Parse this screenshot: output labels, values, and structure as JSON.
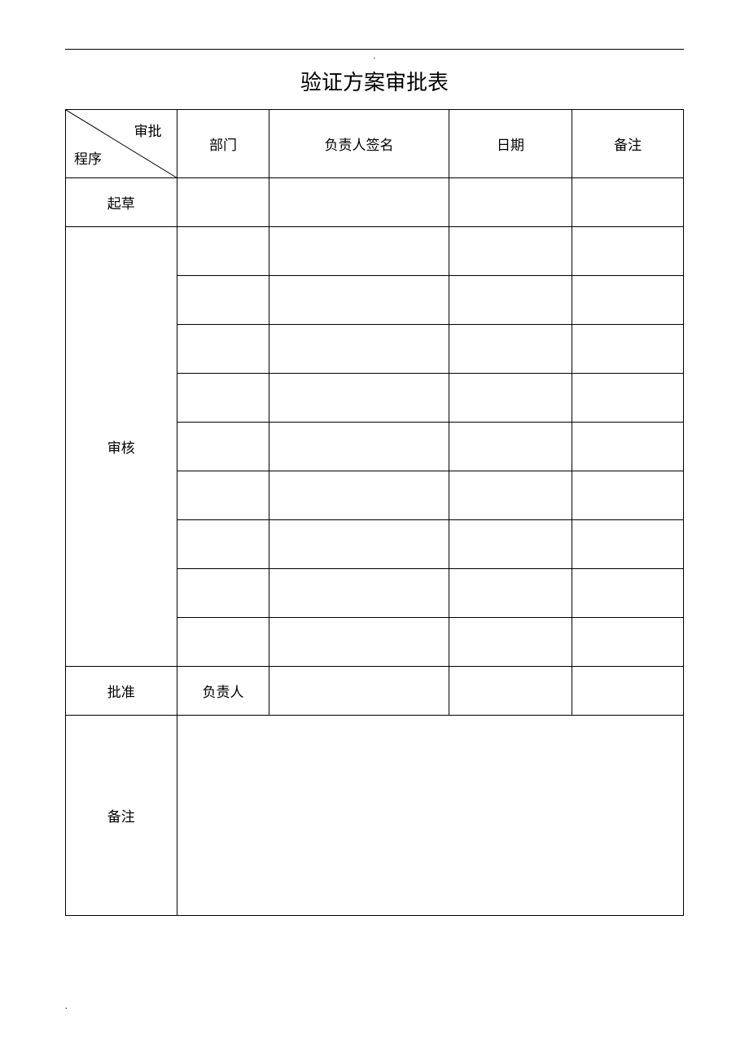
{
  "title": "验证方案审批表",
  "header": {
    "diag_top": "审批",
    "diag_bottom": "程序",
    "dept": "部门",
    "sign": "负责人签名",
    "date": "日期",
    "remark": "备注"
  },
  "rows": {
    "draft": {
      "label": "起草",
      "dept": "",
      "sign": "",
      "date": "",
      "remark": ""
    },
    "review_label": "审核",
    "review": [
      {
        "dept": "",
        "sign": "",
        "date": "",
        "remark": ""
      },
      {
        "dept": "",
        "sign": "",
        "date": "",
        "remark": ""
      },
      {
        "dept": "",
        "sign": "",
        "date": "",
        "remark": ""
      },
      {
        "dept": "",
        "sign": "",
        "date": "",
        "remark": ""
      },
      {
        "dept": "",
        "sign": "",
        "date": "",
        "remark": ""
      },
      {
        "dept": "",
        "sign": "",
        "date": "",
        "remark": ""
      },
      {
        "dept": "",
        "sign": "",
        "date": "",
        "remark": ""
      },
      {
        "dept": "",
        "sign": "",
        "date": "",
        "remark": ""
      },
      {
        "dept": "",
        "sign": "",
        "date": "",
        "remark": ""
      }
    ],
    "approve": {
      "label": "批准",
      "dept": "负责人",
      "sign": "",
      "date": "",
      "remark": ""
    },
    "notes": {
      "label": "备注",
      "content": ""
    }
  },
  "top_mark": ".",
  "footer_mark": "."
}
